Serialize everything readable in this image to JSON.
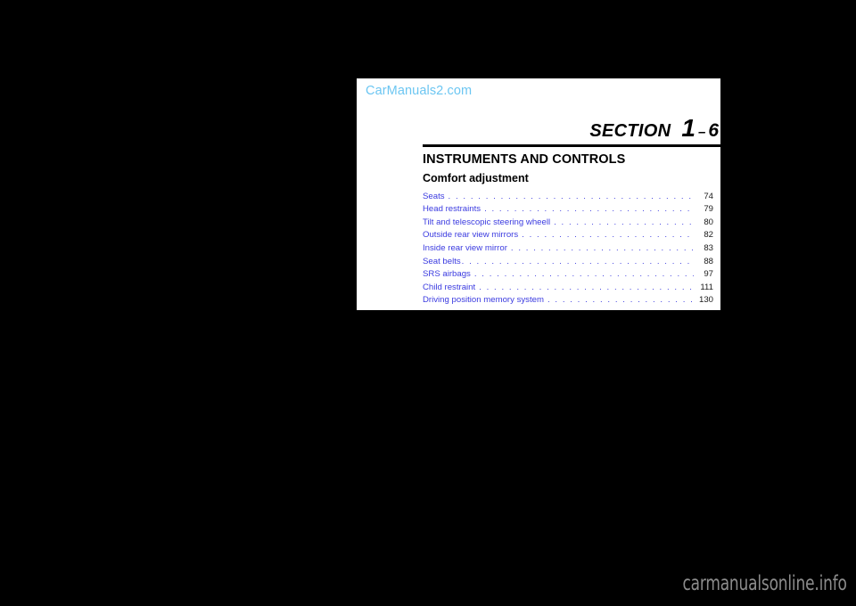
{
  "page": {
    "background_color": "#000000",
    "sheet_color": "#ffffff",
    "site_logo": "CarManuals2.com",
    "logo_color": "#6CC6F2",
    "bottom_watermark": "carmanualsonline.info",
    "watermark_color": "#8c8c8c"
  },
  "header": {
    "section_word": "SECTION",
    "section_number": "1",
    "section_dash": "–",
    "section_sub": "6",
    "chapter_title": "INSTRUMENTS AND CONTROLS",
    "group_title": "Comfort adjustment",
    "link_color": "#3B3BE0"
  },
  "toc": {
    "entries": [
      {
        "label": "Seats",
        "page": "74"
      },
      {
        "label": "Head restraints",
        "page": "79"
      },
      {
        "label": "Tilt and telescopic steering wheell",
        "page": "80"
      },
      {
        "label": "Outside rear view mirrors",
        "page": "82"
      },
      {
        "label": "Inside rear view mirror",
        "page": "83"
      },
      {
        "label": "Seat belts",
        "page": "88"
      },
      {
        "label": "SRS airbags",
        "page": "97"
      },
      {
        "label": "Child restraint",
        "page": "111"
      },
      {
        "label": "Driving position memory system",
        "page": "130"
      }
    ]
  }
}
